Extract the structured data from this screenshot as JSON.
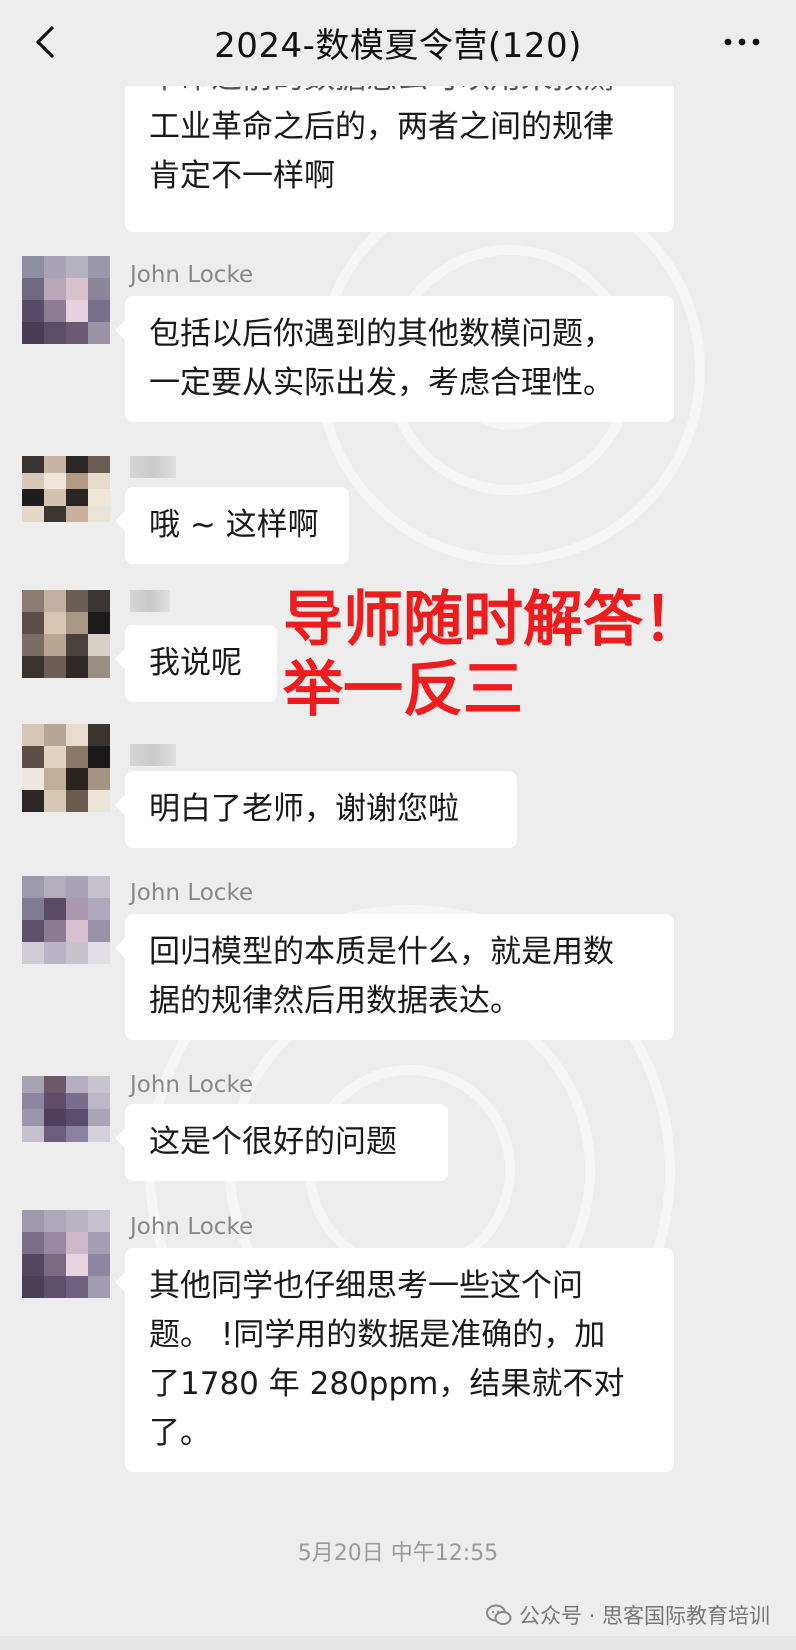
{
  "header": {
    "title": "2024-数模夏令营(120)",
    "back_icon": "chevron-left-icon",
    "more_icon": "more-dots-icon"
  },
  "messages": [
    {
      "sender": "",
      "text_lines": [
        "革命之前的数据怎么可以用来预测",
        "工业革命之后的，两者之间的规律",
        "肯定不一样啊"
      ]
    },
    {
      "sender": "John Locke",
      "text_lines": [
        "包括以后你遇到的其他数模问题，",
        "一定要从实际出发，考虑合理性。"
      ]
    },
    {
      "sender": "",
      "text_lines": [
        "哦 ~ 这样啊"
      ]
    },
    {
      "sender": "",
      "text_lines": [
        "我说呢"
      ]
    },
    {
      "sender": "",
      "text_lines": [
        "明白了老师，谢谢您啦"
      ]
    },
    {
      "sender": "John Locke",
      "text_lines": [
        "回归模型的本质是什么，就是用数",
        "据的规律然后用数据表达。"
      ]
    },
    {
      "sender": "John Locke",
      "text_lines": [
        "这是个很好的问题"
      ]
    },
    {
      "sender": "John Locke",
      "text_lines": [
        "其他同学也仔细思考一些这个问",
        "题。 !同学用的数据是准确的，加",
        "了1780 年 280ppm，结果就不对",
        "了。"
      ]
    }
  ],
  "overlay": {
    "line1": "导师随时解答！",
    "line2": "举一反三",
    "color": "#ee1c1c"
  },
  "timestamp": "5月20日 中午12:55",
  "footer": {
    "watermark_text": "公众号 · 思客国际教育培训",
    "icon": "wechat-icon"
  },
  "colors": {
    "background": "#ededed",
    "bubble": "#ffffff",
    "text": "#1a1a1a",
    "sender": "#888888"
  }
}
